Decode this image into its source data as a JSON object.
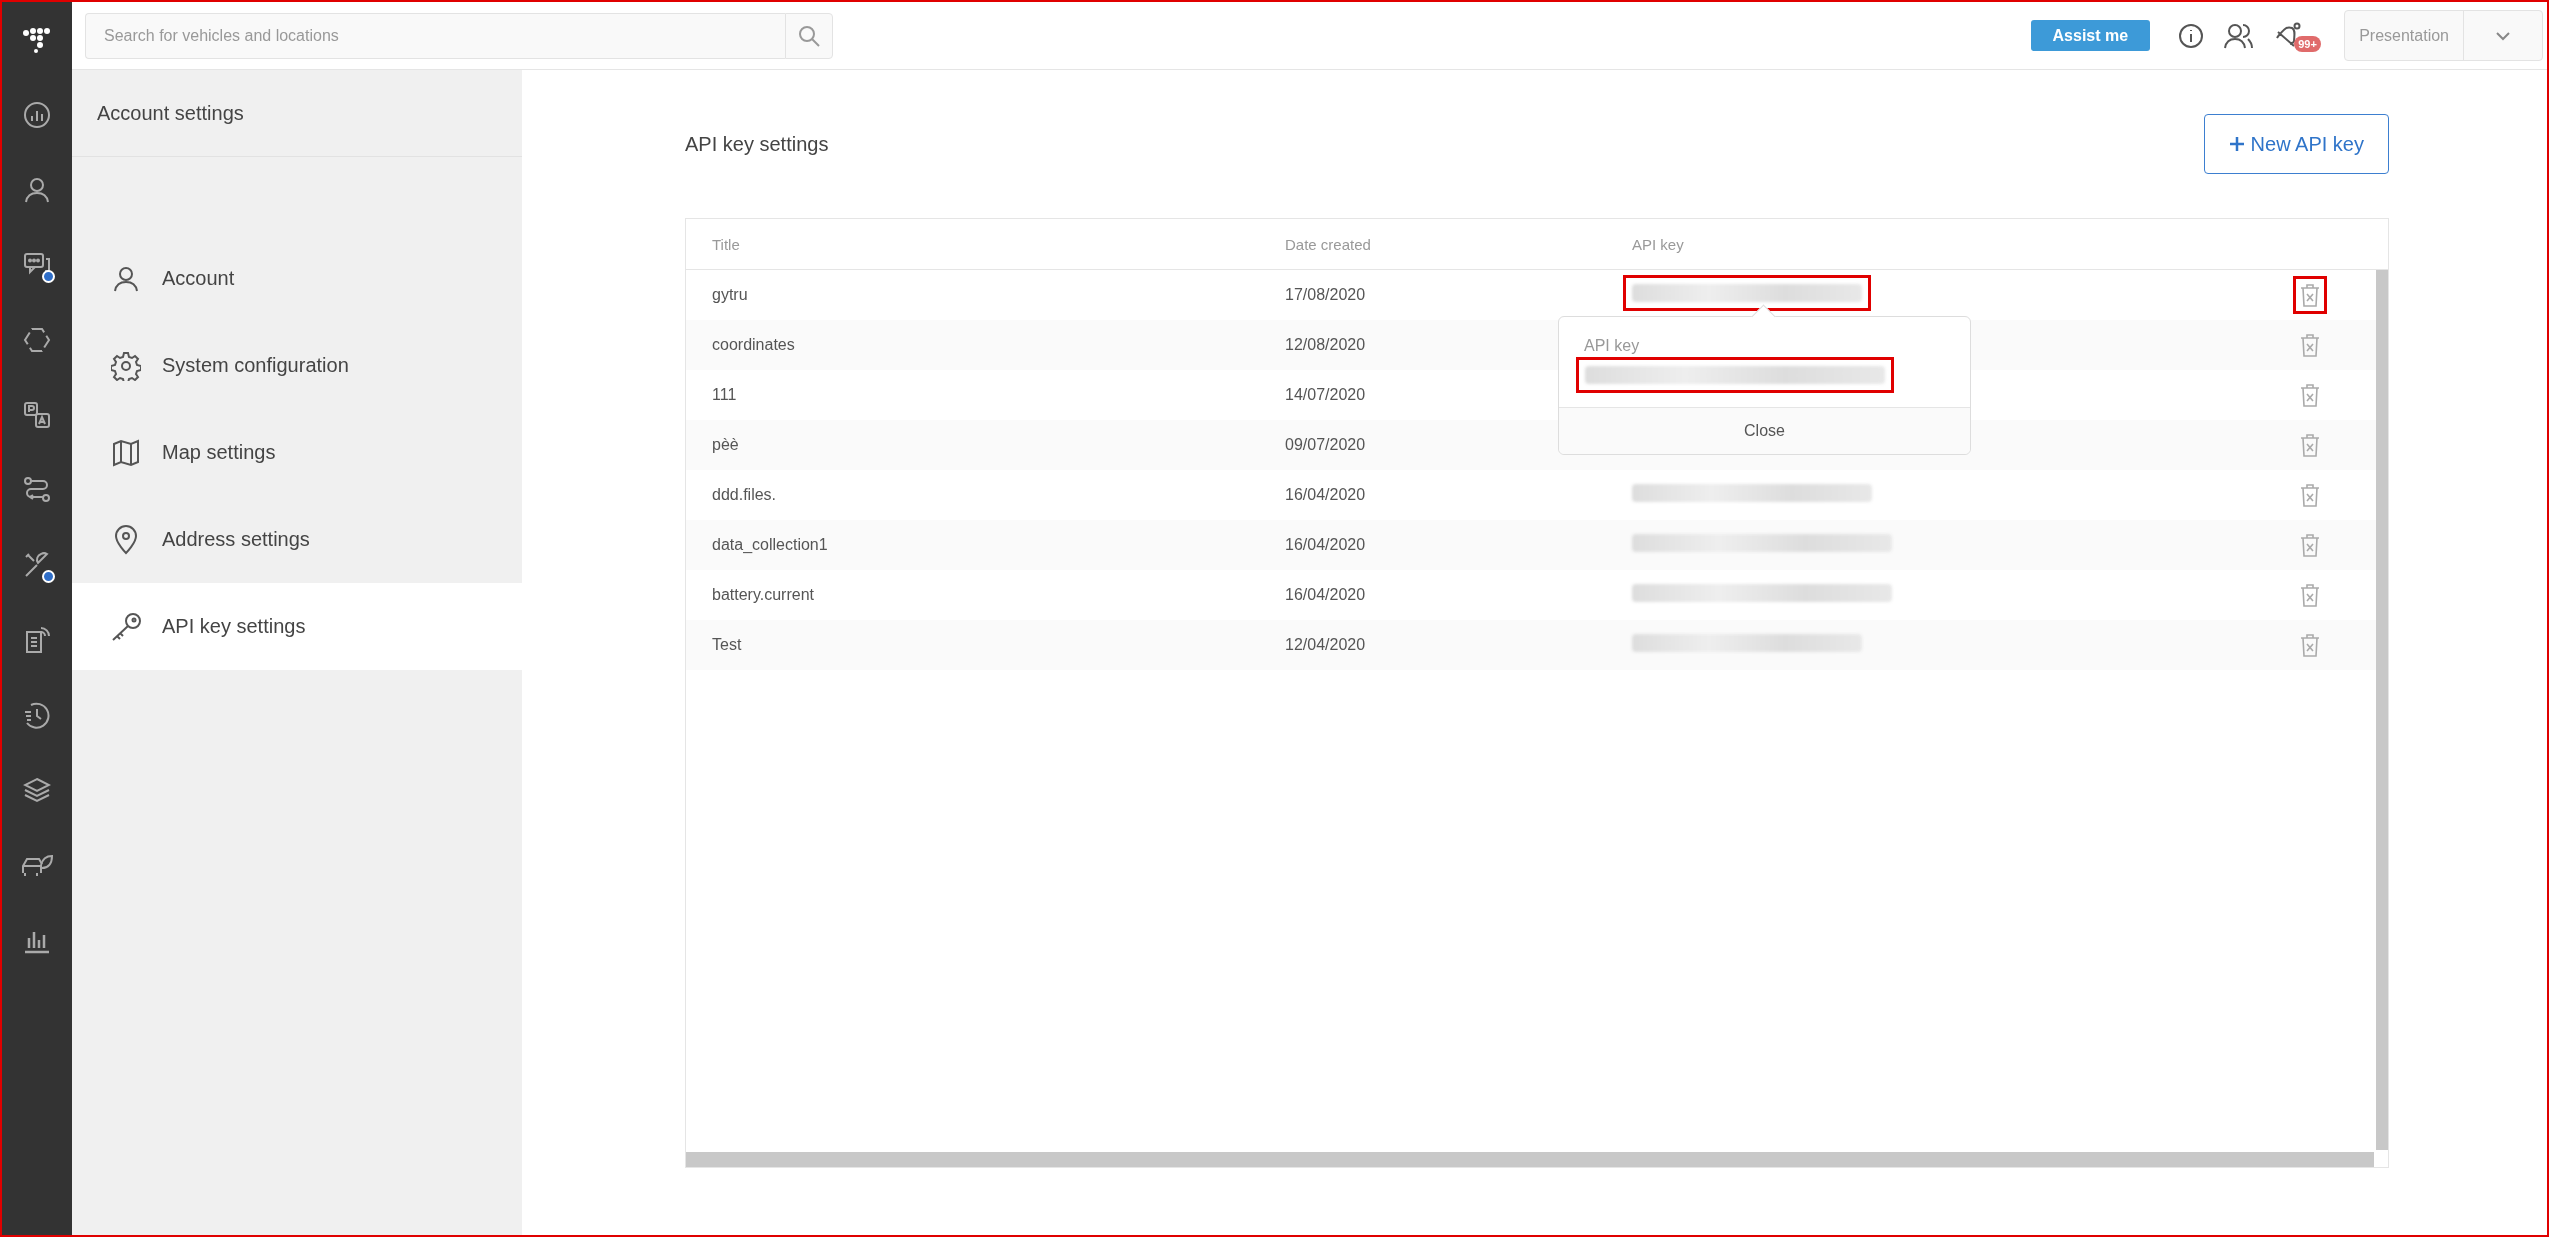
{
  "rail": [
    {
      "kind": "logo",
      "dot": false
    },
    {
      "kind": "dashboard",
      "dot": false
    },
    {
      "kind": "person",
      "dot": false
    },
    {
      "kind": "chat",
      "dot": true
    },
    {
      "kind": "hexagon",
      "dot": false
    },
    {
      "kind": "translate",
      "dot": false
    },
    {
      "kind": "route",
      "dot": false
    },
    {
      "kind": "tools",
      "dot": true
    },
    {
      "kind": "document",
      "dot": false
    },
    {
      "kind": "history",
      "dot": false
    },
    {
      "kind": "layers",
      "dot": false
    },
    {
      "kind": "car",
      "dot": false
    },
    {
      "kind": "barchart",
      "dot": false
    }
  ],
  "top_bar": {
    "search": {
      "placeholder": "Search for vehicles and locations"
    },
    "assist_button": "Assist me",
    "notification_badge": "99+",
    "profile_dropdown": "Presentation"
  },
  "sidebar": {
    "title": "Account settings",
    "items": [
      {
        "kind": "person",
        "label": "Account",
        "selected": false
      },
      {
        "kind": "gear",
        "label": "System configuration",
        "selected": false
      },
      {
        "kind": "map",
        "label": "Map settings",
        "selected": false
      },
      {
        "kind": "pin",
        "label": "Address settings",
        "selected": false
      },
      {
        "kind": "key",
        "label": "API key settings",
        "selected": true
      }
    ]
  },
  "main": {
    "title": "API key settings",
    "new_button": "New API key",
    "table": {
      "columns": [
        "Title",
        "Date created",
        "API key"
      ],
      "rows": [
        {
          "title": "gytru",
          "date": "17/08/2020",
          "key_marked": true,
          "delete_marked": true
        },
        {
          "title": "coordinates",
          "date": "12/08/2020",
          "delete_marked": false
        },
        {
          "title": "111",
          "date": "14/07/2020",
          "delete_marked": false
        },
        {
          "title": "pèè",
          "date": "09/07/2020",
          "delete_marked": false
        },
        {
          "title": "ddd.files.",
          "date": "16/04/2020",
          "key_marked": false,
          "delete_marked": false
        },
        {
          "title": "data_collection1",
          "date": "16/04/2020",
          "key_marked": false,
          "delete_marked": false
        },
        {
          "title": "battery.current",
          "date": "16/04/2020",
          "key_marked": false,
          "delete_marked": false
        },
        {
          "title": "Test",
          "date": "12/04/2020",
          "key_marked": false,
          "delete_marked": false
        }
      ]
    },
    "popup": {
      "label": "API key",
      "key_marked": true,
      "close_button": "Close"
    }
  }
}
